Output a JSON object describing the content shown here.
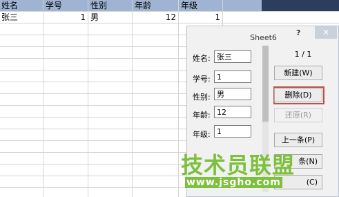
{
  "sheet": {
    "headers": [
      "姓名",
      "学号",
      "性别",
      "年龄",
      "年级"
    ],
    "row1": [
      "张三",
      "1",
      "男",
      "12",
      "1"
    ]
  },
  "dialog": {
    "title": "Sheet6",
    "help": "?",
    "close": "✕",
    "counter": "1 / 1",
    "fields": [
      {
        "label": "姓名:",
        "value": "张三"
      },
      {
        "label": "学号:",
        "value": "1"
      },
      {
        "label": "性别:",
        "value": "男"
      },
      {
        "label": "年龄:",
        "value": "12"
      },
      {
        "label": "年级:",
        "value": "1"
      }
    ],
    "buttons": {
      "new": "新建(W)",
      "delete": "删除(D)",
      "restore": "还原(R)",
      "prev": "上一条(P)",
      "next": "条(N)",
      "criteria": "(C)"
    }
  },
  "watermark": {
    "text": "技术员联盟",
    "url": "www.jsgho.com"
  },
  "colors": {
    "header_band": "#9fb4d3",
    "highlight": "#c0504d",
    "watermark": "#7cc03b"
  }
}
